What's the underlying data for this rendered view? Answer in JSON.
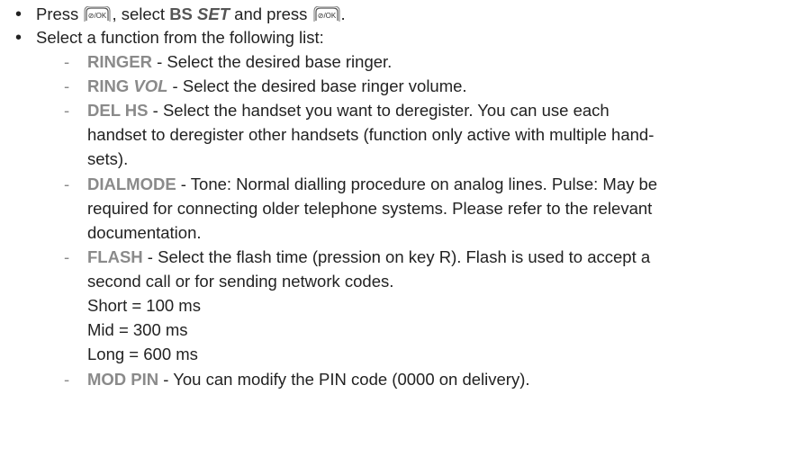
{
  "key_icon_label": "⊘/OK",
  "line1": {
    "a": "Press ",
    "b": ", select ",
    "kw1": "BS",
    "kw2": "SET",
    "c": " and press ",
    "d": "."
  },
  "line2": "Select a function from the following list:",
  "items": [
    {
      "dash": "-",
      "kw": "RINGER",
      "kw_suffix": "",
      "text": " - Select the desired base ringer."
    },
    {
      "dash": "-",
      "kw": "RING",
      "kw_suffix": "VOL",
      "text": " - Select the desired base ringer volume."
    },
    {
      "dash": "-",
      "kw": "DEL HS",
      "kw_suffix": "",
      "text": " - Select the handset you want to deregister. You can use each"
    },
    {
      "dash": "-",
      "kw": "DIALMODE",
      "kw_suffix": "",
      "text": " - Tone: Normal dialling procedure on analog lines. Pulse: May be"
    },
    {
      "dash": "-",
      "kw": "FLASH",
      "kw_suffix": "",
      "text": " - Select the flash time (pression on key R). Flash is used to accept a"
    },
    {
      "dash": "-",
      "kw": "MOD PIN",
      "kw_suffix": "",
      "text": " - You can modify the PIN code (0000 on delivery)."
    }
  ],
  "continuations": {
    "delhs_1": "handset to deregister other handsets (function only active with multiple hand-",
    "delhs_2": "sets).",
    "dial_1": "required for connecting older telephone systems. Please refer to the relevant",
    "dial_2": "documentation.",
    "flash_1": "second call or for sending network codes.",
    "flash_short": "Short = 100 ms",
    "flash_mid": "Mid = 300 ms",
    "flash_long": "Long = 600 ms"
  },
  "bullet_char": "•"
}
